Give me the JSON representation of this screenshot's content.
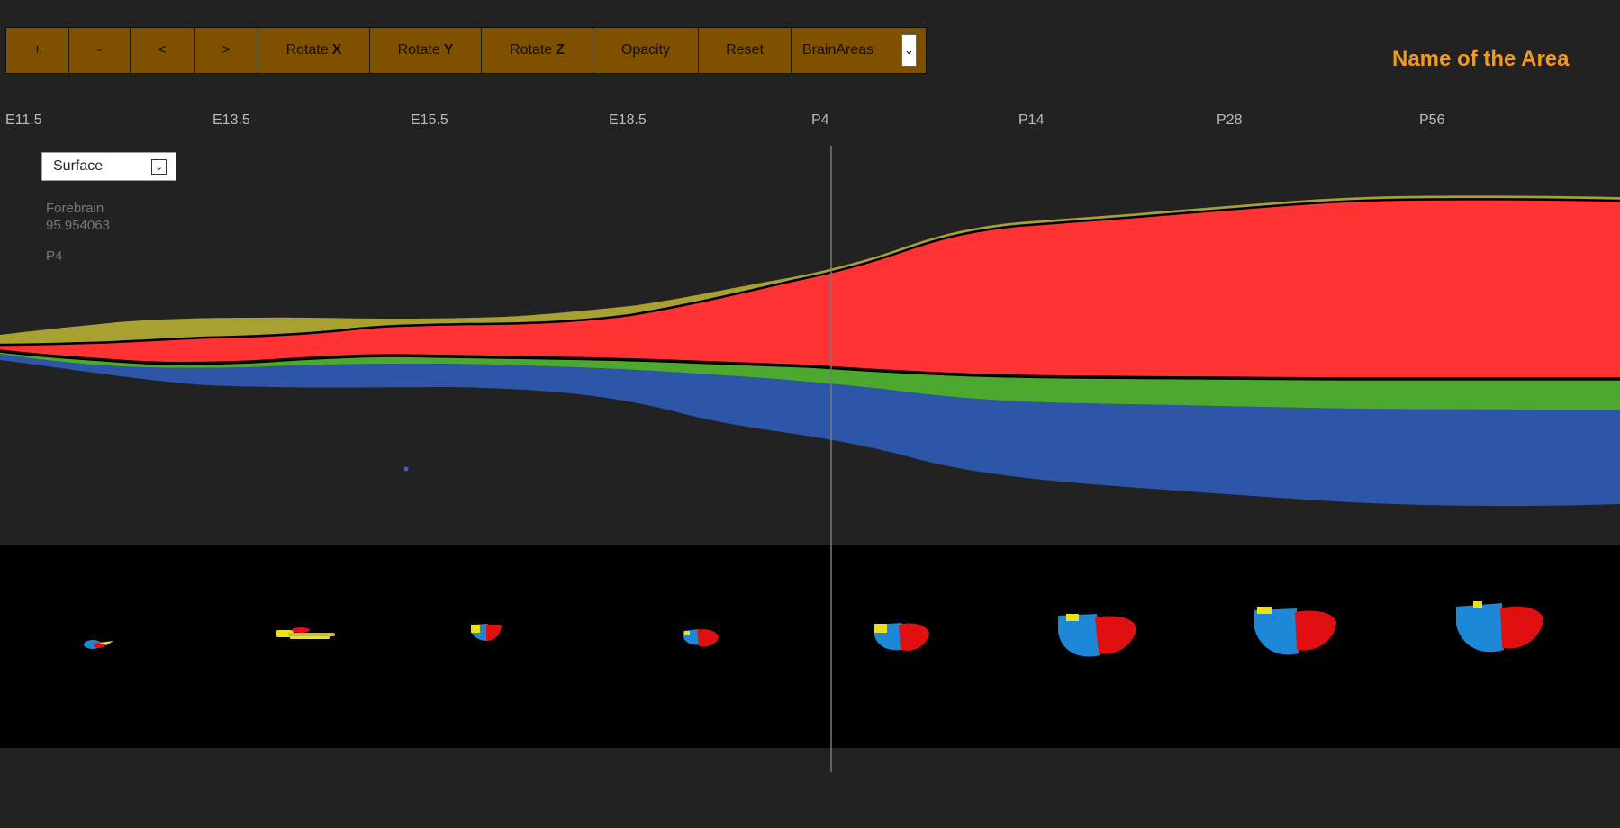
{
  "toolbar": {
    "zoom_in": "+",
    "zoom_out": "-",
    "prev": "<",
    "next": ">",
    "rotate_x": "Rotate",
    "rotate_x_axis": "X",
    "rotate_y": "Rotate",
    "rotate_y_axis": "Y",
    "rotate_z": "Rotate",
    "rotate_z_axis": "Z",
    "opacity": "Opacity",
    "reset": "Reset",
    "dataset_select": "BrainAreas"
  },
  "area_title": "Name of the Area",
  "stages": [
    "E11.5",
    "E13.5",
    "E15.5",
    "E18.5",
    "P4",
    "P14",
    "P28",
    "P56"
  ],
  "mode_select": "Surface",
  "info": {
    "area": "Forebrain",
    "value": "95.954063",
    "stage": "P4"
  },
  "chart_data": {
    "type": "area",
    "x": [
      "E11.5",
      "E13.5",
      "E15.5",
      "E18.5",
      "P4",
      "P14",
      "P28",
      "P56"
    ],
    "series": [
      {
        "color": "#a8a030"
      },
      {
        "color": "#ff3333"
      },
      {
        "color": "#4ca82e"
      },
      {
        "color": "#2d55a8"
      }
    ],
    "grid": false
  },
  "colors": {
    "toolbar_bg": "#7f5000",
    "title_orange": "#f39a1e",
    "background": "#222222",
    "brain_blue": "#1e88d8",
    "brain_red": "#e01010",
    "brain_yellow": "#e8e020"
  }
}
